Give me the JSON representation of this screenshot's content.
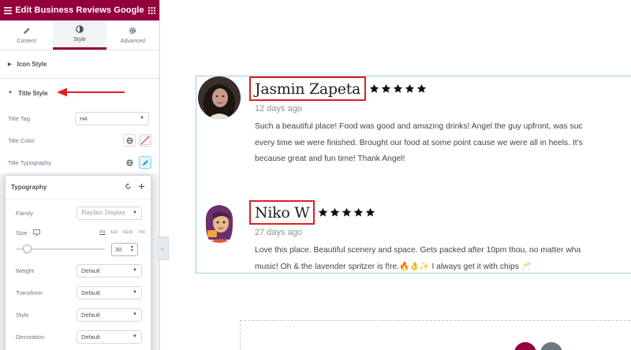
{
  "editor": {
    "title": "Edit Business Reviews Google",
    "tabs": [
      {
        "label": "Content",
        "icon": "pencil-icon"
      },
      {
        "label": "Style",
        "icon": "contrast-icon",
        "active": true
      },
      {
        "label": "Advanced",
        "icon": "gear-icon"
      }
    ],
    "sections": {
      "icon_style": "Icon Style",
      "title_style": "Title Style"
    },
    "controls": {
      "title_tag_label": "Title Tag",
      "title_tag_value": "H4",
      "title_color_label": "Title Color",
      "title_typography_label": "Title Typography"
    },
    "typography": {
      "header": "Typography",
      "family_label": "Family",
      "family_value": "Playfair Display",
      "size_label": "Size",
      "units": [
        "PX",
        "EM",
        "REM",
        "VW"
      ],
      "size_value": "30",
      "weight_label": "Weight",
      "weight_value": "Default",
      "transform_label": "Transform",
      "transform_value": "Default",
      "style_label": "Style",
      "style_value": "Default",
      "decoration_label": "Decoration",
      "decoration_value": "Default"
    }
  },
  "colors": {
    "brand": "#93003c",
    "highlight": "#e02020",
    "star": "#111111"
  },
  "reviews": [
    {
      "name": "Jasmin Zapeta",
      "rating": 5,
      "date": "12 days ago",
      "lines": [
        "Such a beautiful place! Food was good and amazing drinks! Angel the guy upfront, was suc",
        "every time we were finished. Brought our food at some point cause we were all in heels. It's",
        "because great and fun time! Thank Angel!"
      ]
    },
    {
      "name": "Niko W",
      "rating": 5,
      "date": "27 days ago",
      "lines": [
        "Love this place. Beautiful scenery and space. Gets packed after 10pm thou, no matter wha",
        "music! Oh & the lavender spritzer is f!re.🔥👌✨ I always get it with chips 🥂"
      ]
    }
  ]
}
